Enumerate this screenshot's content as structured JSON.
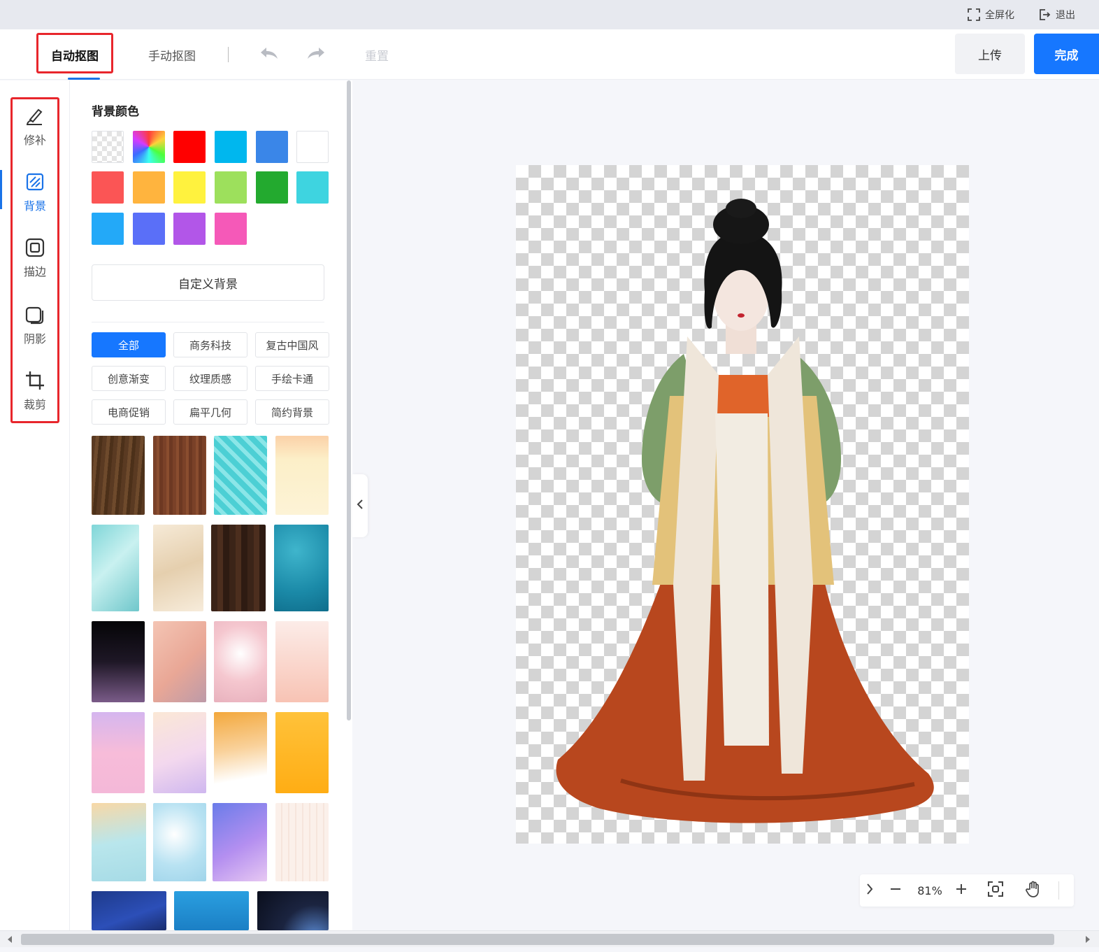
{
  "system_bar": {
    "fullscreen_label": "全屏化",
    "exit_label": "退出"
  },
  "toolbar": {
    "tab_auto": "自动抠图",
    "tab_manual": "手动抠图",
    "reset_label": "重置",
    "upload_label": "上传",
    "done_label": "完成"
  },
  "rail": {
    "items": [
      {
        "label": "修补",
        "icon": "brush-icon"
      },
      {
        "label": "背景",
        "icon": "background-icon"
      },
      {
        "label": "描边",
        "icon": "stroke-icon"
      },
      {
        "label": "阴影",
        "icon": "shadow-icon"
      },
      {
        "label": "裁剪",
        "icon": "crop-icon"
      }
    ],
    "active": "背景"
  },
  "panel": {
    "title": "背景颜色",
    "colors": [
      "transparent",
      "spectrum",
      "#ff0000",
      "#00b7ee",
      "#3a86e8",
      "#ffffff",
      "#fb5555",
      "#ffb43e",
      "#fff23e",
      "#9de05c",
      "#23aa2f",
      "#3ed4e0",
      "#23a9f8",
      "#5a6ff8",
      "#b256e8",
      "#f559b8"
    ],
    "custom_bg_label": "自定义背景",
    "categories": [
      "全部",
      "商务科技",
      "复古中国风",
      "创意渐变",
      "纹理质感",
      "手绘卡通",
      "电商促销",
      "扁平几何",
      "简约背景"
    ],
    "active_category": "全部"
  },
  "zoom": {
    "value": "81%"
  }
}
